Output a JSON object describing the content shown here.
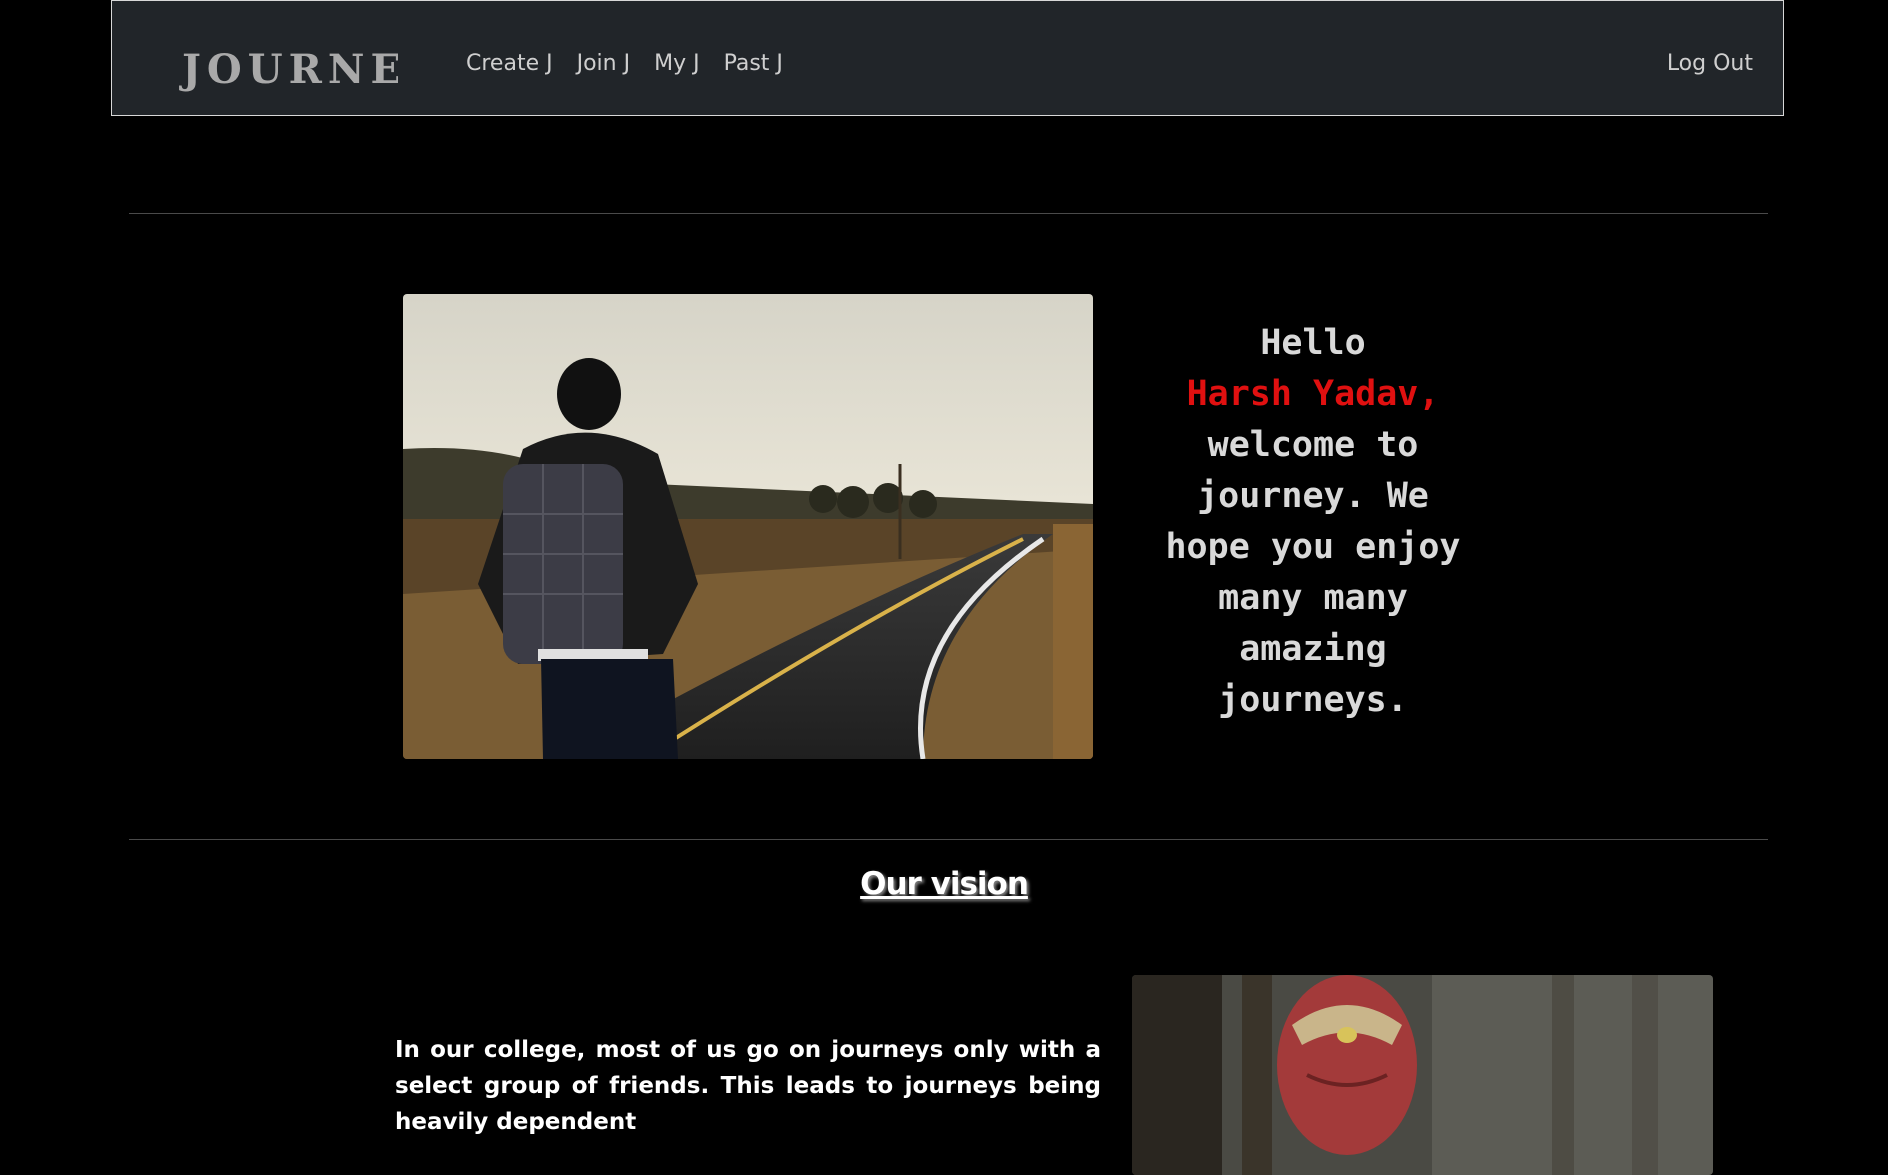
{
  "navbar": {
    "brand": "JOURNEY",
    "links": [
      "Create J",
      "Join J",
      "My J",
      "Past J"
    ],
    "logout": "Log Out"
  },
  "hero": {
    "image_alt": "backpacker walking on road",
    "greeting": "Hello",
    "user_name": "Harsh Yadav,",
    "message_lines": [
      "welcome to",
      "journey. We",
      "hope you enjoy",
      "many many",
      "amazing",
      "journeys."
    ]
  },
  "vision": {
    "title": "Our vision",
    "text": "In our college, most of us go on journeys only with a select group of friends. This leads to journeys being heavily dependent",
    "image_alt": "vision character portrait"
  },
  "colors": {
    "navbar_bg": "#212529",
    "accent_red": "#e01010",
    "text_light": "#d9d9d9"
  }
}
